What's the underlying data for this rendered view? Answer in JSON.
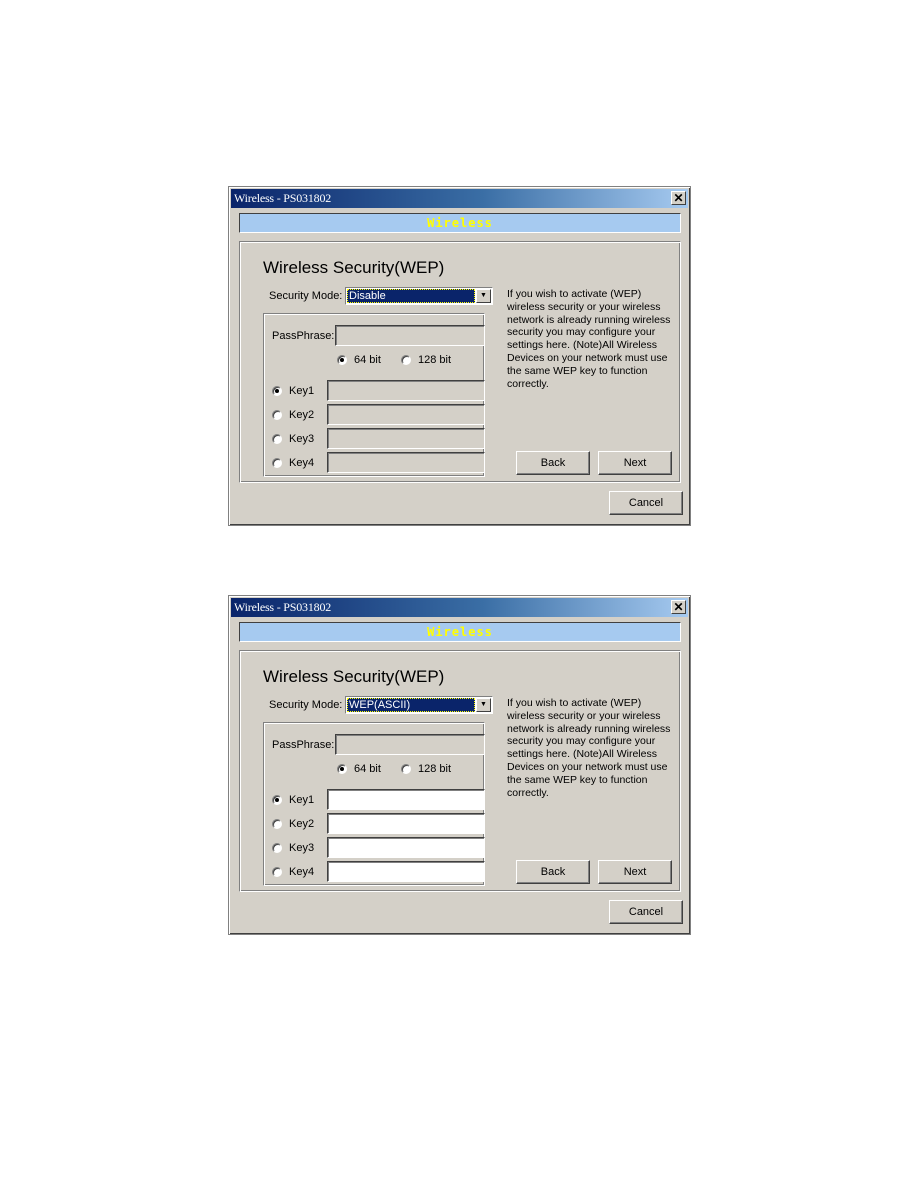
{
  "dialogs": [
    {
      "title": "Wireless - PS031802",
      "close_glyph": "✕",
      "banner": "Wireless",
      "heading": "Wireless Security(WEP)",
      "security_mode": {
        "label": "Security Mode:",
        "selected": "Disable",
        "arrow_glyph": "▼"
      },
      "passphrase": {
        "label": "PassPhrase:",
        "value": "",
        "enabled": false
      },
      "key_length": [
        {
          "label": "64 bit",
          "checked": true
        },
        {
          "label": "128 bit",
          "checked": false
        }
      ],
      "keys": [
        {
          "label": "Key1",
          "checked": true,
          "value": "",
          "enabled": false
        },
        {
          "label": "Key2",
          "checked": false,
          "value": "",
          "enabled": false
        },
        {
          "label": "Key3",
          "checked": false,
          "value": "",
          "enabled": false
        },
        {
          "label": "Key4",
          "checked": false,
          "value": "",
          "enabled": false
        }
      ],
      "info_text": "If you wish to activate (WEP) wireless security or your wireless network is already running wireless security you may configure your settings here. (Note)All Wireless Devices on your network must use the same WEP key to function correctly.",
      "buttons": {
        "back": "Back",
        "next": "Next",
        "cancel": "Cancel"
      }
    },
    {
      "title": "Wireless - PS031802",
      "close_glyph": "✕",
      "banner": "Wireless",
      "heading": "Wireless Security(WEP)",
      "security_mode": {
        "label": "Security Mode:",
        "selected": "WEP(ASCII)",
        "arrow_glyph": "▼"
      },
      "passphrase": {
        "label": "PassPhrase:",
        "value": "",
        "enabled": false
      },
      "key_length": [
        {
          "label": "64 bit",
          "checked": true
        },
        {
          "label": "128 bit",
          "checked": false
        }
      ],
      "keys": [
        {
          "label": "Key1",
          "checked": true,
          "value": "",
          "enabled": true
        },
        {
          "label": "Key2",
          "checked": false,
          "value": "",
          "enabled": true
        },
        {
          "label": "Key3",
          "checked": false,
          "value": "",
          "enabled": true
        },
        {
          "label": "Key4",
          "checked": false,
          "value": "",
          "enabled": true
        }
      ],
      "info_text": "If you wish to activate (WEP) wireless security or your wireless network is already running wireless security you may configure your settings here. (Note)All Wireless Devices on your network must use the same WEP key to function correctly.",
      "buttons": {
        "back": "Back",
        "next": "Next",
        "cancel": "Cancel"
      }
    }
  ],
  "colors": {
    "window_bg": "#d4d0c8",
    "title_active_start": "#0a246a",
    "title_active_end": "#a6caf0",
    "banner_bg": "#a6caf0",
    "banner_text": "#ffff00",
    "selection_bg": "#0a246a"
  }
}
